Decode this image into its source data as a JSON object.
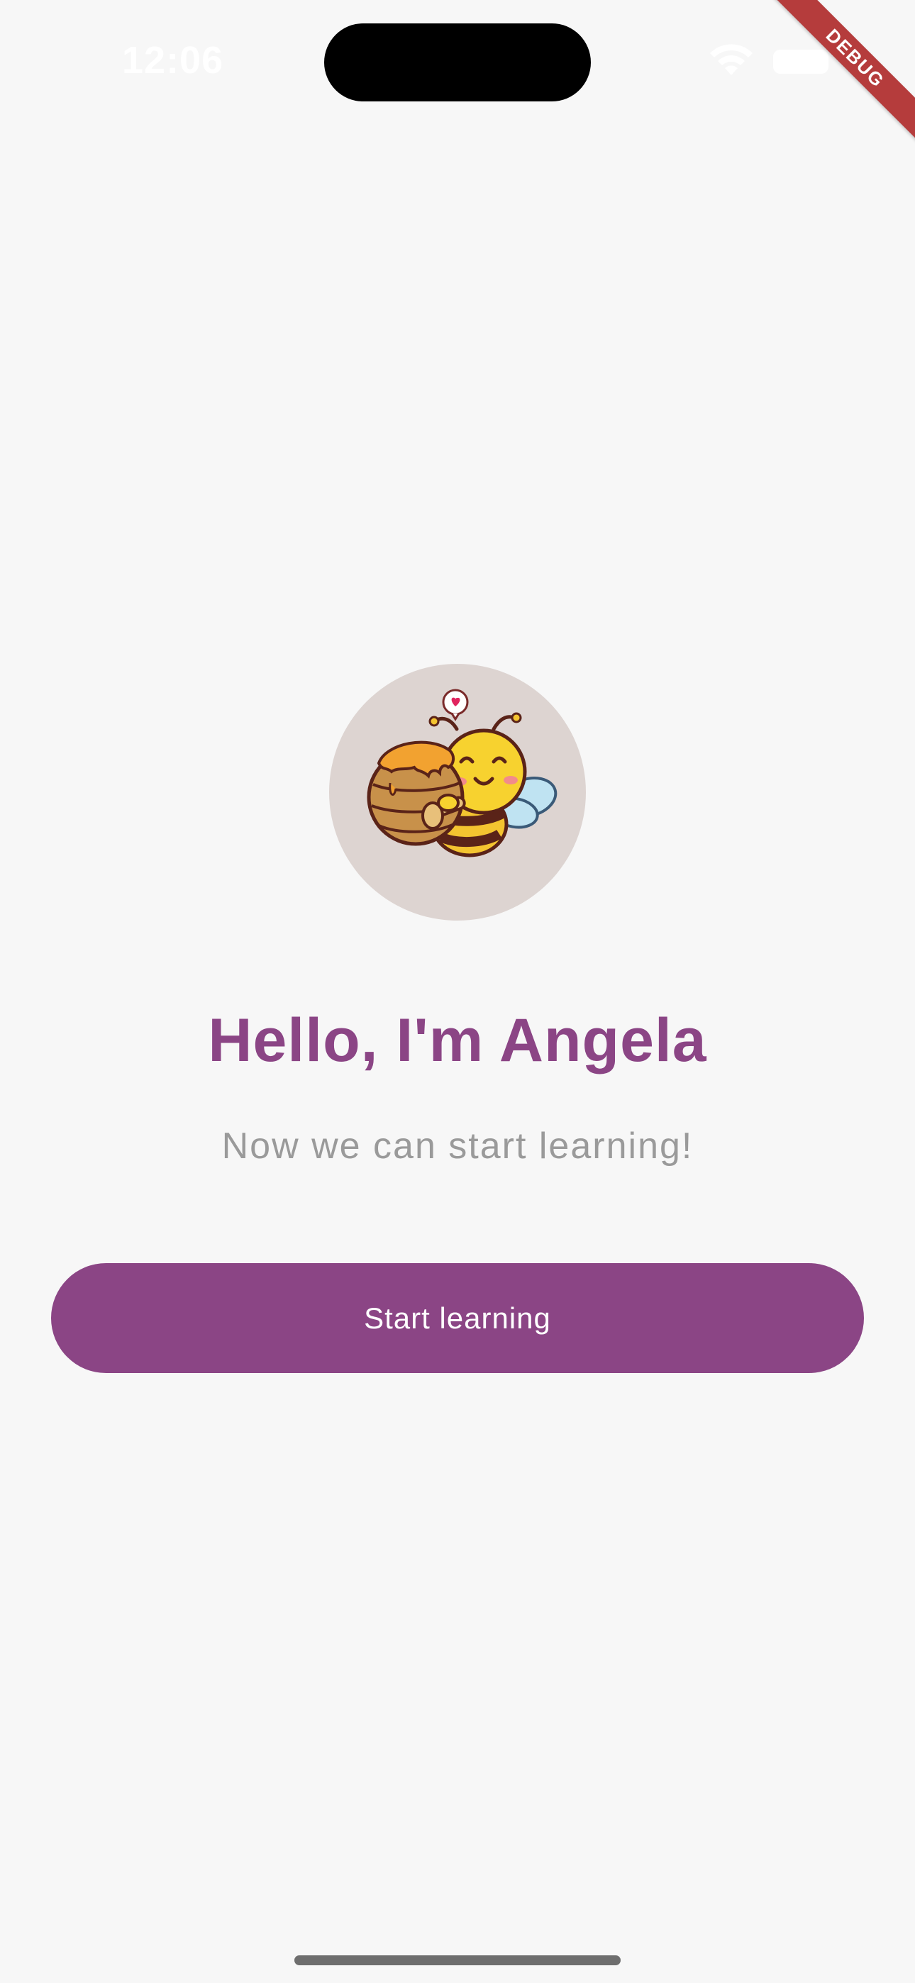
{
  "status_bar": {
    "time": "12:06"
  },
  "debug_banner": {
    "label": "DEBUG"
  },
  "avatar": {
    "icon": "bee-hugging-honey-pot-avatar",
    "background_color": "#ddd4d1"
  },
  "welcome": {
    "title": "Hello, I'm Angela",
    "subtitle": "Now we can start learning!"
  },
  "actions": {
    "start_label": "Start learning"
  },
  "colors": {
    "accent": "#8b4585",
    "background": "#f7f7f7",
    "subtitle": "#9a9a9a"
  }
}
